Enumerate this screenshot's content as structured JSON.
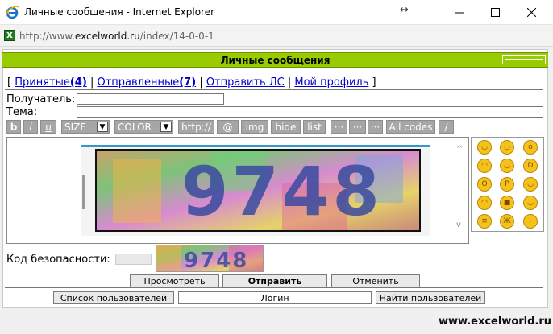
{
  "window": {
    "title": "Личные сообщения - Internet Explorer",
    "url_prefix": "http://www.",
    "url_domain": "excelworld.ru",
    "url_path": "/index/14-0-0-1"
  },
  "panel": {
    "title": "Личные сообщения"
  },
  "nav": {
    "open_bracket": "[",
    "inbox_label": "Принятые",
    "inbox_count": "(4)",
    "sent_label": "Отправленные",
    "sent_count": "(7)",
    "send_label": "Отправить ЛС",
    "profile_label": "Мой профиль",
    "close_bracket": "]",
    "separator": "|"
  },
  "form": {
    "recipient_label": "Получатель:",
    "recipient_value": "",
    "subject_label": "Тема:",
    "subject_value": ""
  },
  "toolbar": {
    "bold": "b",
    "italic": "i",
    "underline": "u",
    "size": "SIZE",
    "color": "COLOR",
    "http": "http://",
    "at": "@",
    "img": "img",
    "hide": "hide",
    "list": "list",
    "more1": "···",
    "more2": "···",
    "more3": "···",
    "all_codes": "All codes",
    "slash": "/"
  },
  "captcha": {
    "text": "9748",
    "label": "Код безопасности:"
  },
  "buttons": {
    "preview": "Просмотреть",
    "send": "Отправить",
    "cancel": "Отменить",
    "user_list": "Список пользователей",
    "login_value": "Логин",
    "find_users": "Найти пользователей"
  },
  "watermark": "www.excelworld.ru",
  "colors": {
    "header": "#99cc00",
    "link": "#0000cc",
    "toolbar": "#a6a6a6",
    "captcha_bar": "#3399cc"
  },
  "smileys": [
    "smile-icon",
    "grin-icon",
    "shock-icon",
    "sad-icon",
    "wink-icon",
    "laugh-icon",
    "surprised-icon",
    "tongue-icon",
    "happy-icon",
    "angry-icon",
    "cool-icon",
    "blush-icon",
    "read-icon",
    "scared-icon",
    "neutral-icon"
  ]
}
